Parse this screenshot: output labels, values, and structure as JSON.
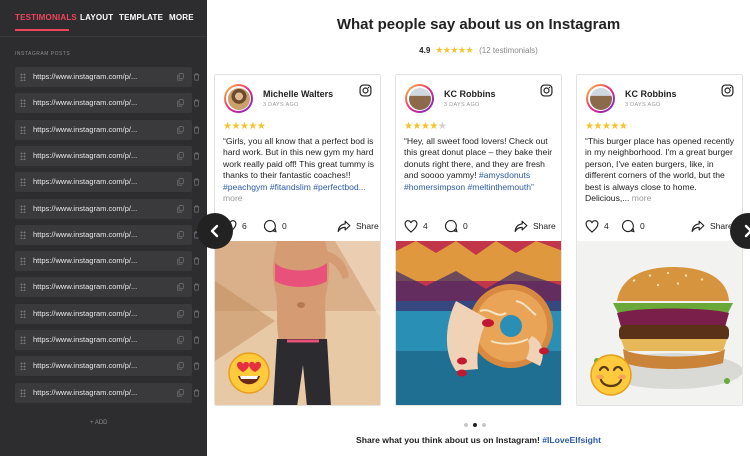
{
  "sidebar": {
    "tabs": [
      {
        "label": "TESTIMONIALS",
        "active": true
      },
      {
        "label": "LAYOUT",
        "active": false
      },
      {
        "label": "TEMPLATE",
        "active": false
      },
      {
        "label": "MORE",
        "active": false
      }
    ],
    "section_label": "INSTAGRAM POSTS",
    "posts": [
      {
        "url": "https://www.instagram.com/p/..."
      },
      {
        "url": "https://www.instagram.com/p/..."
      },
      {
        "url": "https://www.instagram.com/p/..."
      },
      {
        "url": "https://www.instagram.com/p/..."
      },
      {
        "url": "https://www.instagram.com/p/..."
      },
      {
        "url": "https://www.instagram.com/p/..."
      },
      {
        "url": "https://www.instagram.com/p/..."
      },
      {
        "url": "https://www.instagram.com/p/..."
      },
      {
        "url": "https://www.instagram.com/p/..."
      },
      {
        "url": "https://www.instagram.com/p/..."
      },
      {
        "url": "https://www.instagram.com/p/..."
      },
      {
        "url": "https://www.instagram.com/p/..."
      },
      {
        "url": "https://www.instagram.com/p/..."
      }
    ],
    "add_label": "+ ADD"
  },
  "main": {
    "title": "What people say about us on Instagram",
    "rating_value": "4.9",
    "rating_stars": "★★★★★",
    "rating_count": "(12 testimonials)",
    "cards": [
      {
        "name": "Michelle Walters",
        "date": "3 DAYS AGO",
        "rating": 5,
        "text": "“Girls, you all know that a perfect bod is hard work. But in this new gym my hard work really paid off! This great tummy is thanks to their fantastic coaches!! ",
        "tags": "#peachgym #fitandslim #perfectbod...",
        "more": " more",
        "likes": "6",
        "comments": "0",
        "share": "Share",
        "photo_icon": "fitness-photo",
        "emoji": "heart-eyes-emoji"
      },
      {
        "name": "KC Robbins",
        "date": "3 DAYS AGO",
        "rating": 4,
        "text": "“Hey, all sweet food lovers! Check out this great donut place – they bake their donuts right there, and they are fresh and soooo yammy! ",
        "tags": "#amysdonuts #homersimpson #meltinthemouth”",
        "more": "",
        "likes": "4",
        "comments": "0",
        "share": "Share",
        "photo_icon": "donut-photo",
        "emoji": ""
      },
      {
        "name": "KC Robbins",
        "date": "3 DAYS AGO",
        "rating": 5,
        "text": "“This burger place has opened recently in my neighborhood. I'm a great burger person, I've eaten burgers, like, in different corners of the world, but the best is always close to home. Delicious,...",
        "tags": "",
        "more": " more",
        "likes": "4",
        "comments": "0",
        "share": "Share",
        "photo_icon": "burger-photo",
        "emoji": "smiling-emoji"
      }
    ],
    "cta_text": "Share what you think about us on Instagram! ",
    "cta_hashtag": "#ILoveElfsight",
    "pagination": {
      "total": 3,
      "active": 1
    }
  },
  "colors": {
    "accent": "#f0445c",
    "sidebar_bg": "#2d2d2f",
    "star": "#f5c42c",
    "link": "#2a5ba8"
  }
}
